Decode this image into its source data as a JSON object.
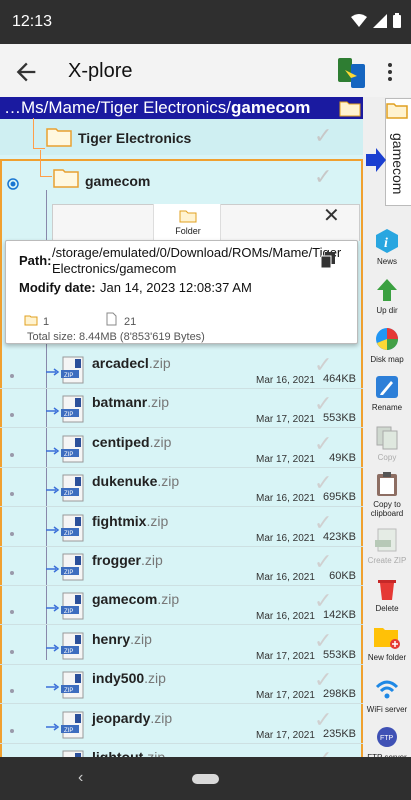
{
  "status": {
    "time": "12:13"
  },
  "app": {
    "title": "X-plore"
  },
  "path_bar": {
    "prefix": "…Ms/Mame/Tiger Electronics/",
    "current": "gamecom"
  },
  "tree": {
    "parent": "Tiger Electronics",
    "current": "gamecom"
  },
  "popup": {
    "tab": "Folder",
    "path_label": "Path:",
    "path_value": "/storage/emulated/0/Download/ROMs/Mame/Tiger Electronics/gamecom",
    "modify_label": "Modify date:",
    "modify_value": "Jan 14, 2023 12:08:37 AM",
    "folder_count": "1",
    "file_count": "21",
    "total_size": "Total size:  8.44MB (8'853'619 Bytes)"
  },
  "files": [
    {
      "name": "arcadecl",
      "ext": ".zip",
      "date": "Mar 16, 2021",
      "size": "464KB"
    },
    {
      "name": "batmanr",
      "ext": ".zip",
      "date": "Mar 17, 2021",
      "size": "553KB"
    },
    {
      "name": "centiped",
      "ext": ".zip",
      "date": "Mar 17, 2021",
      "size": "49KB"
    },
    {
      "name": "dukenuke",
      "ext": ".zip",
      "date": "Mar 16, 2021",
      "size": "695KB"
    },
    {
      "name": "fightmix",
      "ext": ".zip",
      "date": "Mar 16, 2021",
      "size": "423KB"
    },
    {
      "name": "frogger",
      "ext": ".zip",
      "date": "Mar 16, 2021",
      "size": "60KB"
    },
    {
      "name": "gamecom",
      "ext": ".zip",
      "date": "Mar 16, 2021",
      "size": "142KB"
    },
    {
      "name": "henry",
      "ext": ".zip",
      "date": "Mar 17, 2021",
      "size": "553KB"
    },
    {
      "name": "indy500",
      "ext": ".zip",
      "date": "Mar 17, 2021",
      "size": "298KB"
    },
    {
      "name": "jeopardy",
      "ext": ".zip",
      "date": "Mar 17, 2021",
      "size": "235KB"
    },
    {
      "name": "lightout",
      "ext": ".zip",
      "date": "",
      "size": ""
    }
  ],
  "sidebar": {
    "tab_label": "gamecom",
    "tools": [
      {
        "label": "News",
        "icon": "info-icon"
      },
      {
        "label": "Up dir",
        "icon": "up-arrow-icon"
      },
      {
        "label": "Disk map",
        "icon": "pie-chart-icon"
      },
      {
        "label": "Rename",
        "icon": "pencil-icon"
      },
      {
        "label": "Copy",
        "icon": "copy-icon"
      },
      {
        "label": "Copy to clipboard",
        "icon": "clipboard-icon"
      },
      {
        "label": "Create ZIP",
        "icon": "zip-icon"
      },
      {
        "label": "Delete",
        "icon": "trash-icon"
      },
      {
        "label": "New folder",
        "icon": "new-folder-icon"
      },
      {
        "label": "WiFi server",
        "icon": "wifi-icon"
      },
      {
        "label": "FTP server",
        "icon": "ftp-icon"
      }
    ]
  },
  "colors": {
    "path_bar": "#1a1aa0",
    "panel": "#d8f4f6",
    "highlight_border": "#f0a030",
    "nav_bar": "#2f2f2f"
  }
}
